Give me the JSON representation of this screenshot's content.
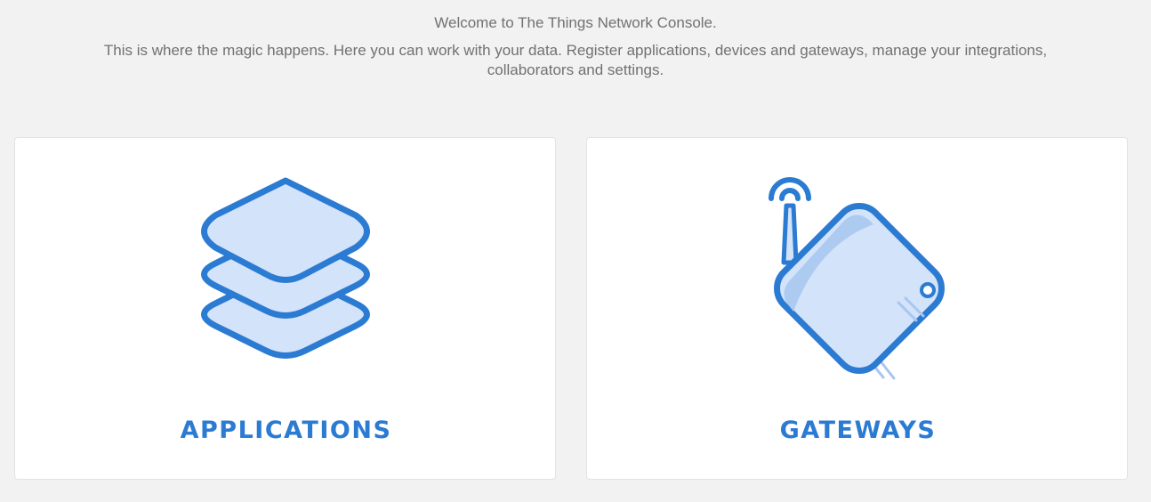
{
  "intro": {
    "welcome": "Welcome to The Things Network Console.",
    "description": "This is where the magic happens. Here you can work with your data. Register applications, devices and gateways, manage your integrations, collaborators and settings."
  },
  "cards": [
    {
      "title": "APPLICATIONS",
      "icon": "layers-icon"
    },
    {
      "title": "GATEWAYS",
      "icon": "gateway-icon"
    }
  ],
  "colors": {
    "background": "#f2f2f2",
    "text": "#717171",
    "accent": "#2b7bd3",
    "accent_fill": "#d3e3f9",
    "accent_shadow": "#a9c6f0",
    "card": "#ffffff"
  }
}
